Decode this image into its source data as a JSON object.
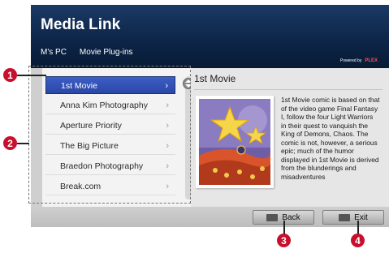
{
  "header": {
    "title": "Media Link",
    "nav": [
      "M's PC",
      "Movie Plug-ins"
    ],
    "powered_prefix": "Powered by",
    "powered_brand": "PLEX"
  },
  "list": {
    "items": [
      {
        "label": "1st Movie",
        "selected": true
      },
      {
        "label": "Anna Kim Photography",
        "selected": false
      },
      {
        "label": "Aperture Priority",
        "selected": false
      },
      {
        "label": "The Big Picture",
        "selected": false
      },
      {
        "label": "Braedon Photography",
        "selected": false
      },
      {
        "label": "Break.com",
        "selected": false
      }
    ]
  },
  "detail": {
    "title": "1st Movie",
    "description": "1st Movie comic is based on that of the video game Final Fantasy I, follow the four Light Warriors in their quest to vanquish the King of Demons, Chaos. The comic is not, however, a serious epic; much of the humor displayed in 1st Movie is derived from the blunderings and misadventures"
  },
  "footer": {
    "back_label": "Back",
    "exit_label": "Exit"
  },
  "callouts": [
    "1",
    "2",
    "3",
    "4"
  ],
  "colors": {
    "header_bg": "#0c2446",
    "selection": "#2c47a6",
    "callout": "#c8102e"
  },
  "icons": {
    "chevron": "chevron-right-icon",
    "scroll": "scroll-up-down-icon",
    "back_key": "remote-back-key-icon",
    "exit_key": "remote-exit-key-icon"
  }
}
